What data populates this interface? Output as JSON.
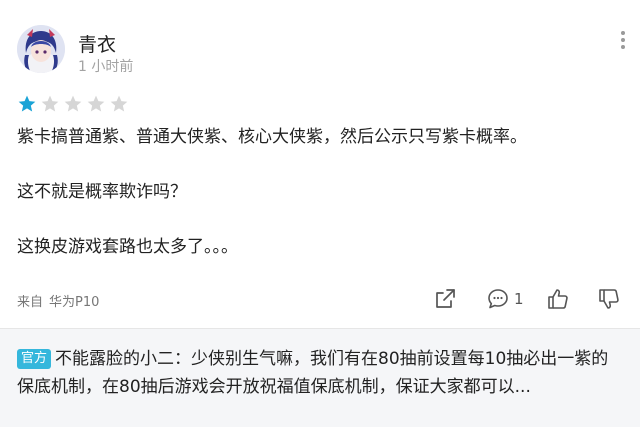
{
  "user": {
    "name": "青衣",
    "time": "1 小时前"
  },
  "rating": {
    "value": 1,
    "max": 5,
    "filled_color": "#1aa3d6",
    "empty_color": "#d6d6d6"
  },
  "review": {
    "paragraphs": [
      "紫卡搞普通紫、普通大侠紫、核心大侠紫，然后公示只写紫卡概率。",
      "这不就是概率欺诈吗？",
      "这换皮游戏套路也太多了。。。"
    ]
  },
  "footer": {
    "device_prefix": "来自",
    "device_name": "华为P10",
    "comment_count": "1"
  },
  "official_reply": {
    "badge": "官方",
    "author": "不能露脸的小二",
    "text": "：少侠别生气嘛，我们有在80抽前设置每10抽必出一紫的保底机制，在80抽后游戏会开放祝福值保底机制，保证大家都可以..."
  },
  "icons": {
    "more": "more-vertical-icon",
    "share": "share-icon",
    "comment": "comment-icon",
    "like": "thumbs-up-icon",
    "dislike": "thumbs-down-icon"
  }
}
